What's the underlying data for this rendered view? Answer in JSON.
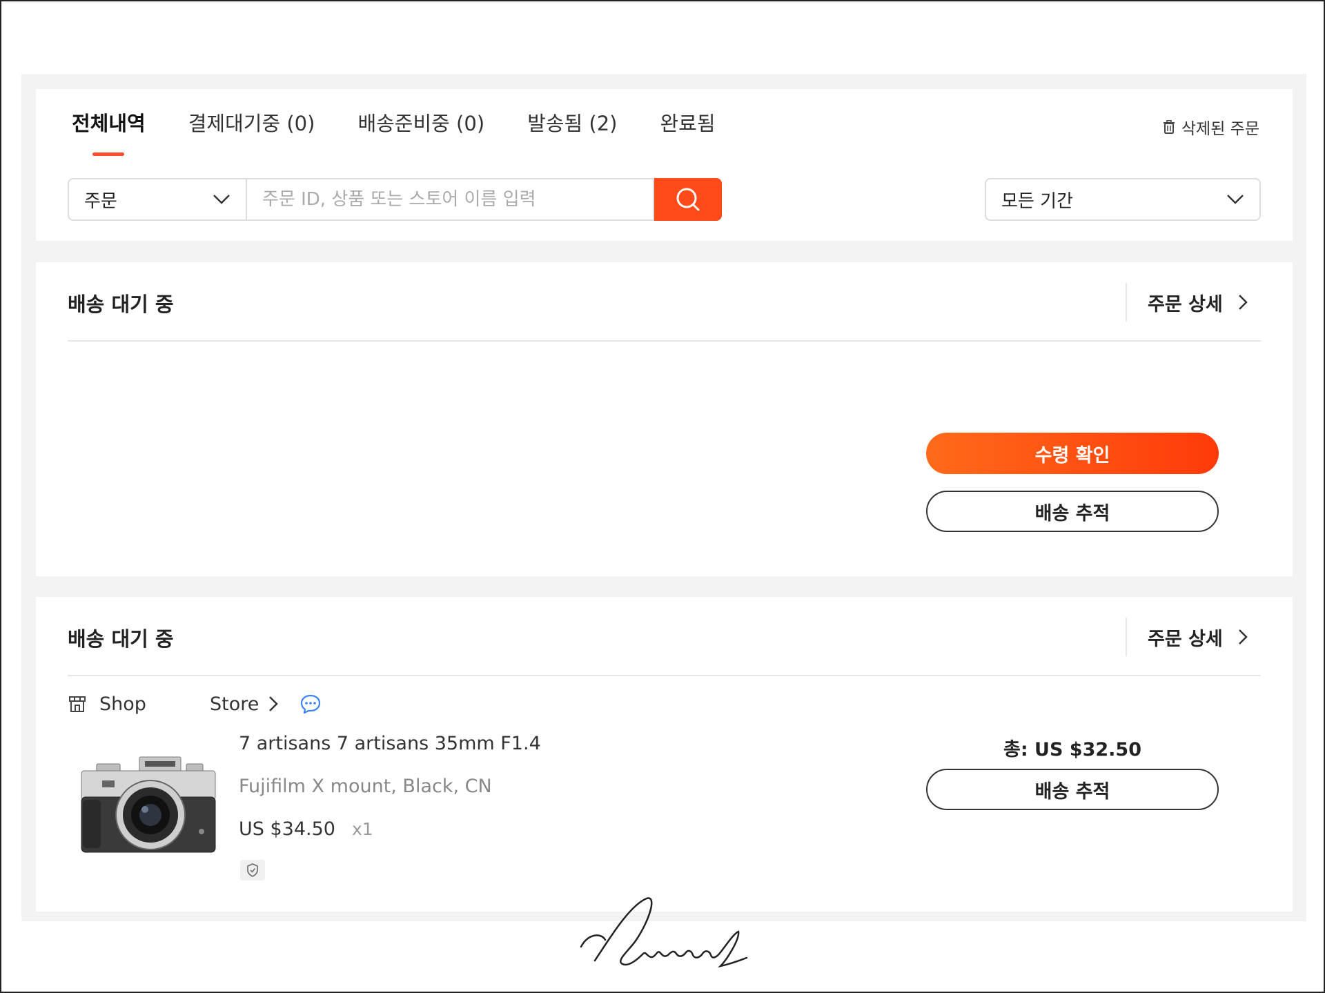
{
  "tabs": [
    {
      "label": "전체내역",
      "active": true
    },
    {
      "label": "결제대기중 (0)",
      "active": false
    },
    {
      "label": "배송준비중 (0)",
      "active": false
    },
    {
      "label": "발송됨 (2)",
      "active": false
    },
    {
      "label": "완료됨",
      "active": false
    }
  ],
  "deleted_orders_label": "삭제된 주문",
  "search": {
    "type_value": "주문",
    "placeholder": "주문 ID, 상품 또는 스토어 이름 입력",
    "period_value": "모든 기간"
  },
  "orders": [
    {
      "status": "배송 대기 중",
      "detail_label": "주문 상세",
      "confirm_label": "수령 확인",
      "track_label": "배송 추적"
    },
    {
      "status": "배송 대기 중",
      "detail_label": "주문 상세",
      "shop_label": "Shop",
      "store_label": "Store",
      "product_title": "7 artisans 7 artisans 35mm F1.4",
      "product_variant": "Fujifilm X mount, Black, CN",
      "product_price": "US $34.50",
      "product_qty": "x1",
      "total": "총: US $32.50",
      "track_label": "배송 추적"
    }
  ],
  "colors": {
    "accent": "#ff4b1a",
    "chat": "#3b82f6"
  }
}
